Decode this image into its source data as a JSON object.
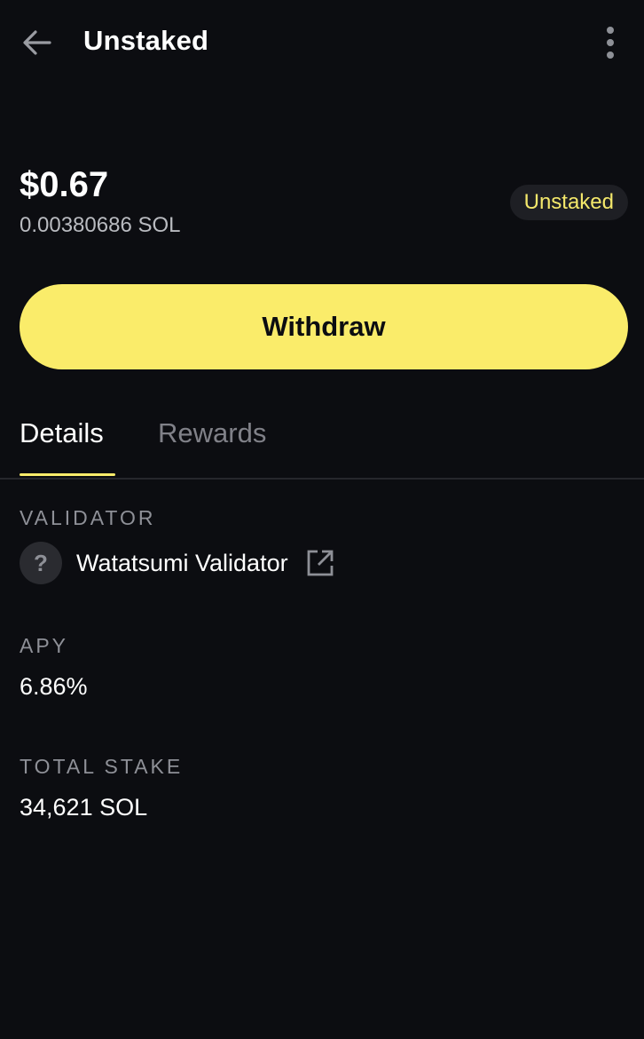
{
  "header": {
    "title": "Unstaked",
    "back_icon": "arrow-left-icon",
    "more_icon": "vertical-dots-icon"
  },
  "balance": {
    "usd": "$0.67",
    "sol": "0.00380686 SOL",
    "status": "Unstaked"
  },
  "actions": {
    "withdraw_label": "Withdraw"
  },
  "tabs": [
    {
      "label": "Details",
      "active": true
    },
    {
      "label": "Rewards",
      "active": false
    }
  ],
  "details": {
    "validator": {
      "label": "VALIDATOR",
      "avatar": "?",
      "name": "Watatsumi Validator",
      "link_icon": "external-link-icon"
    },
    "apy": {
      "label": "APY",
      "value": "6.86%"
    },
    "total_stake": {
      "label": "TOTAL STAKE",
      "value": "34,621 SOL"
    }
  },
  "colors": {
    "background": "#0c0d11",
    "accent": "#faec6a",
    "muted_text": "#8e9097",
    "badge_bg": "#1e1f24"
  }
}
